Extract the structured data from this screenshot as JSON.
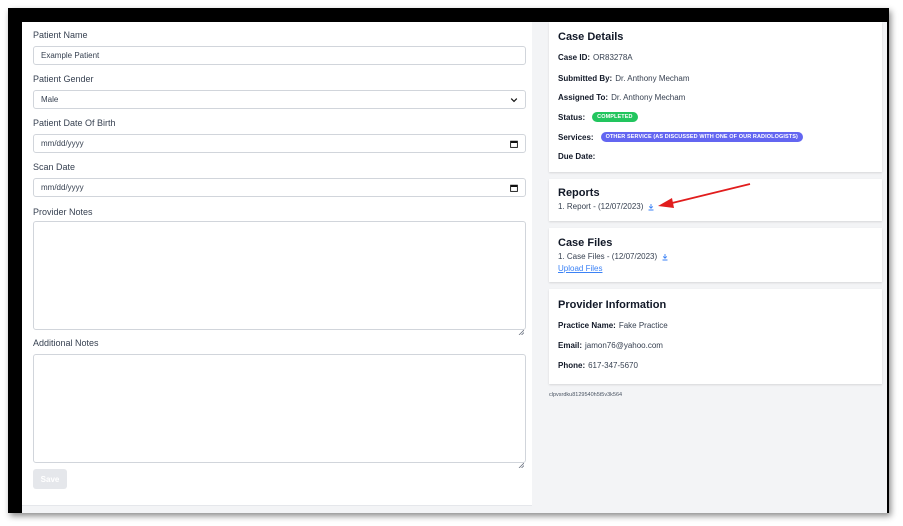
{
  "form": {
    "patient_name_label": "Patient Name",
    "patient_name_value": "Example Patient",
    "gender_label": "Patient Gender",
    "gender_value": "Male",
    "dob_label": "Patient Date Of Birth",
    "dob_placeholder": "mm/dd/yyyy",
    "scan_date_label": "Scan Date",
    "scan_date_placeholder": "mm/dd/yyyy",
    "provider_notes_label": "Provider Notes",
    "additional_notes_label": "Additional Notes",
    "save_label": "Save"
  },
  "case_details": {
    "title": "Case Details",
    "case_id_label": "Case ID:",
    "case_id_value": "OR83278A",
    "submitted_by_label": "Submitted By:",
    "submitted_by_value": "Dr. Anthony Mecham",
    "assigned_to_label": "Assigned To:",
    "assigned_to_value": "Dr. Anthony Mecham",
    "status_label": "Status:",
    "status_value": "COMPLETED",
    "services_label": "Services:",
    "services_value": "OTHER SERVICE (AS DISCUSSED WITH ONE OF OUR RADIOLOGISTS)",
    "due_date_label": "Due Date:"
  },
  "reports": {
    "title": "Reports",
    "items": [
      {
        "label": "1. Report - (12/07/2023)"
      }
    ]
  },
  "case_files": {
    "title": "Case Files",
    "items": [
      {
        "label": "1. Case Files - (12/07/2023)"
      }
    ],
    "upload_label": "Upload Files"
  },
  "provider_info": {
    "title": "Provider Information",
    "practice_label": "Practice Name:",
    "practice_value": "Fake Practice",
    "email_label": "Email:",
    "email_value": "jamon76@yahoo.com",
    "phone_label": "Phone:",
    "phone_value": "617-347-5670"
  },
  "footer_id": "clpvsrdku8129540h5t5v3k564",
  "colors": {
    "status_badge": "#22c55e",
    "services_badge": "#6366f1",
    "link": "#3b82f6",
    "annotation_arrow": "#e11d1d"
  }
}
